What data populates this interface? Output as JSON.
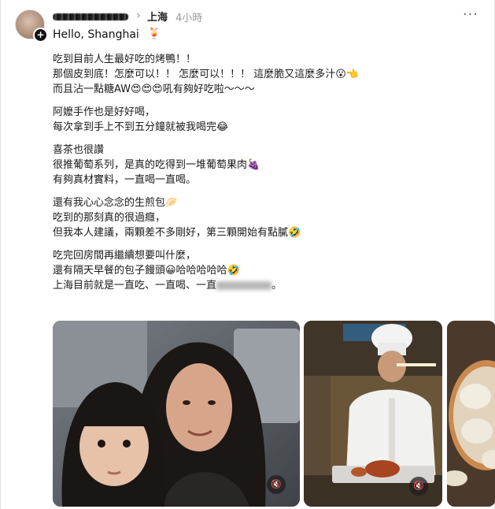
{
  "post": {
    "username": "",
    "chevron": "›",
    "location": "上海",
    "time": "4小時",
    "more": "···",
    "greeting": "Hello, Shanghai",
    "greeting_emoji": "🍹",
    "paragraphs": [
      [
        "吃到目前人生最好吃的烤鴨！！",
        "那個皮到底！怎麼可以！！ 怎麼可以！！！ 這麼脆又這麼多汁😮👈",
        "而且沾一點糖AW😍😍😍吼有夠好吃啦～～～"
      ],
      [
        "阿嬤手作也是好好喝，",
        "每次拿到手上不到五分鐘就被我喝完😂"
      ],
      [
        "喜茶也很讚",
        "很推葡萄系列，是真的吃得到一堆葡萄果肉🍇",
        "有夠真材實料，一直喝一直喝。"
      ],
      [
        "還有我心心念念的生煎包🥟",
        "吃到的那刻真的很過癮，",
        "但我本人建議，兩顆差不多剛好，第三顆開始有點膩🤣"
      ],
      [
        "吃完回房間再繼續想要叫什麼，",
        "還有隔天早餐的包子饅頭😀哈哈哈哈哈🤣",
        "上海目前就是一直吃、一直喝、一直",
        "。"
      ]
    ]
  },
  "media": {
    "mute_icon": "🔇"
  }
}
